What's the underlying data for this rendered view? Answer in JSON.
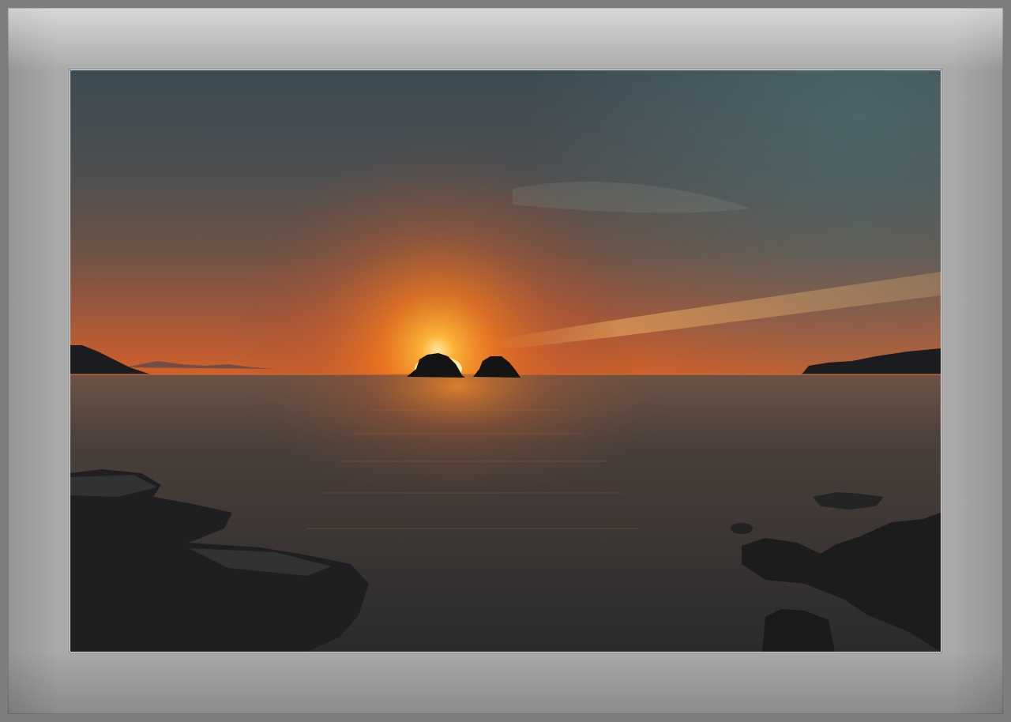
{
  "photo": {
    "subject": "sunset-over-sea",
    "colors": {
      "sky_top": "#3e4f56",
      "sky_mid": "#6e5448",
      "glow": "#ff9a1a",
      "sun": "#ffe08a",
      "sea": "#3a3431",
      "rocks": "#1c1c1d",
      "mat": "#a9a9a9",
      "outer_frame": "#7d7d7d"
    }
  }
}
